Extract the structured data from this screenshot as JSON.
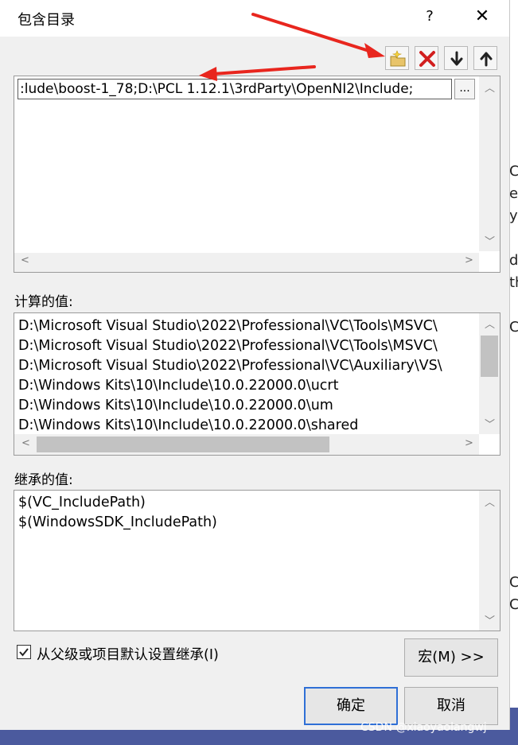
{
  "dialog": {
    "title": "包含目录",
    "help_label": "?",
    "close_label": "✕"
  },
  "toolbar": {
    "buttons": [
      {
        "name": "new-line-icon"
      },
      {
        "name": "delete-icon"
      },
      {
        "name": "move-down-icon"
      },
      {
        "name": "move-up-icon"
      }
    ]
  },
  "editor": {
    "value": ":lude\\boost-1_78;D:\\PCL 1.12.1\\3rdParty\\OpenNI2\\Include;",
    "browse_label": "..."
  },
  "computed": {
    "label": "计算的值:",
    "lines": [
      "D:\\Microsoft Visual Studio\\2022\\Professional\\VC\\Tools\\MSVC\\",
      "D:\\Microsoft Visual Studio\\2022\\Professional\\VC\\Tools\\MSVC\\",
      "D:\\Microsoft Visual Studio\\2022\\Professional\\VC\\Auxiliary\\VS\\",
      "D:\\Windows Kits\\10\\Include\\10.0.22000.0\\ucrt",
      "D:\\Windows Kits\\10\\Include\\10.0.22000.0\\um",
      "D:\\Windows Kits\\10\\Include\\10.0.22000.0\\shared"
    ]
  },
  "inherited": {
    "label": "继承的值:",
    "lines": [
      "$(VC_IncludePath)",
      "$(WindowsSDK_IncludePath)"
    ]
  },
  "inherit_checkbox": {
    "label": "从父级或项目默认设置继承(I)",
    "checked": true
  },
  "buttons": {
    "macros": "宏(M) >>",
    "ok": "确定",
    "cancel": "取消"
  },
  "watermark": "CSDN @xiaoyaolangwj",
  "background_fragments": [
    "C",
    "e",
    "ys",
    "d",
    "th",
    "C_",
    "C",
    "C"
  ],
  "colors": {
    "accent": "#2f6fd6",
    "annotation_arrow": "#e8261e"
  }
}
